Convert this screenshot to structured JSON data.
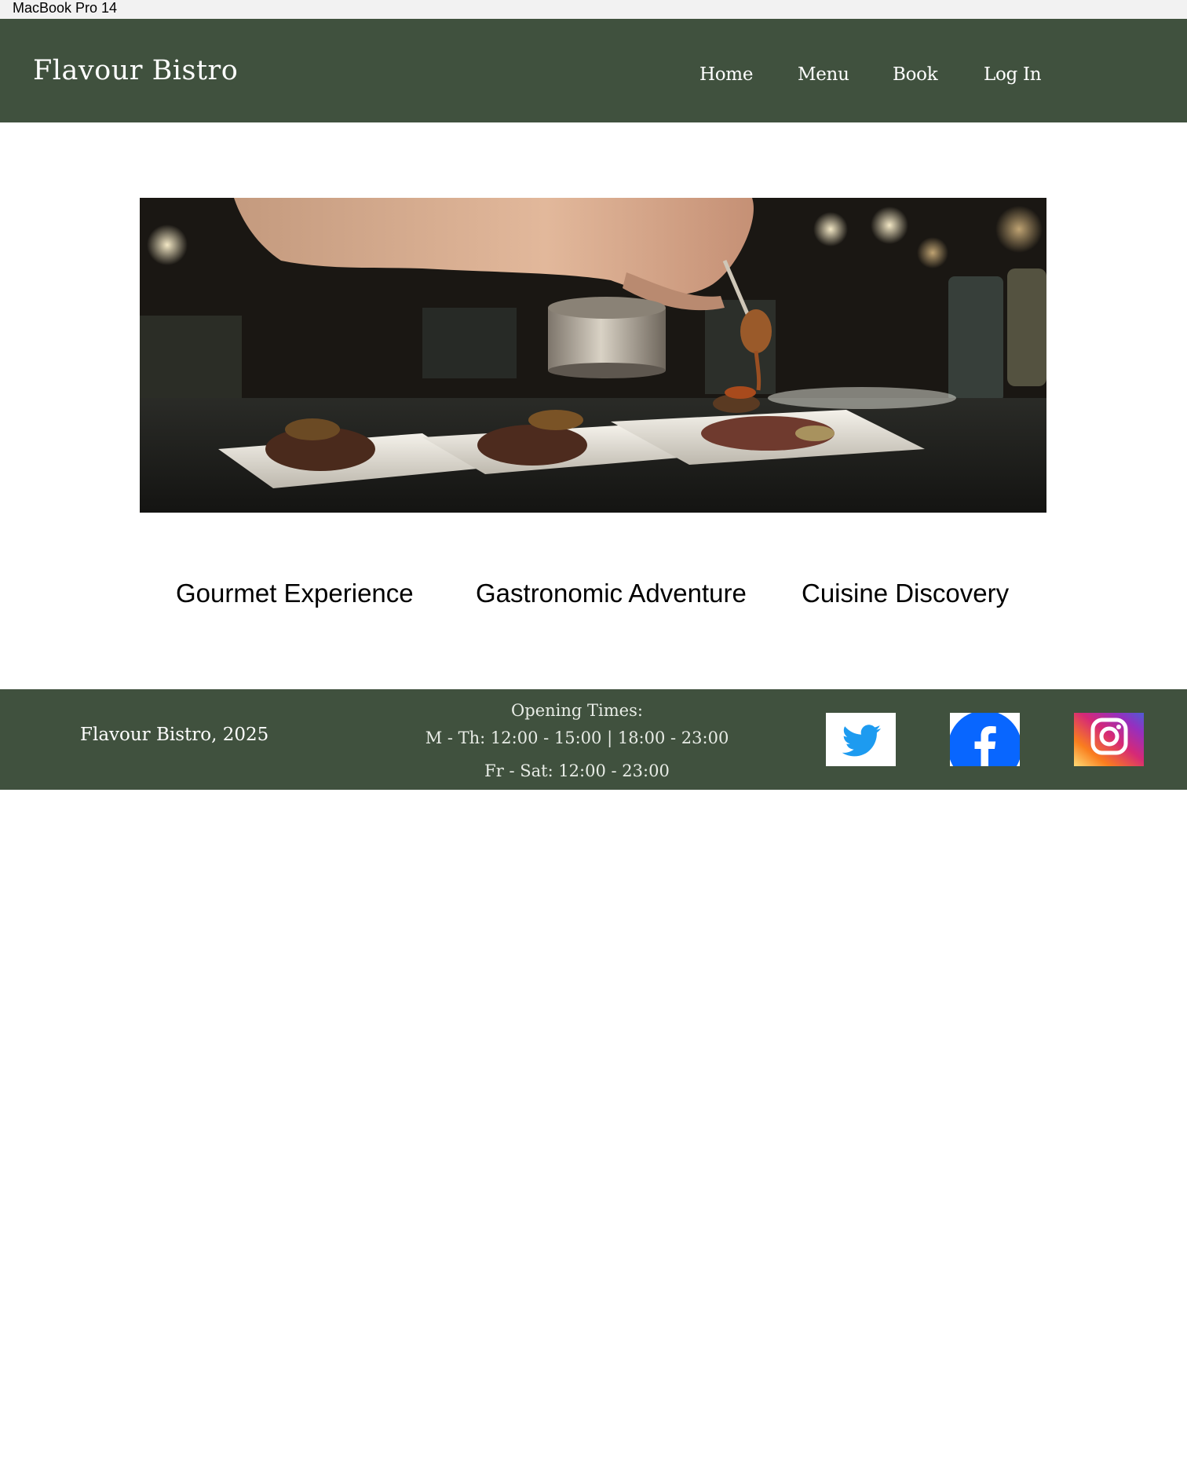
{
  "device_label": "MacBook Pro 14",
  "header": {
    "brand": "Flavour Bistro",
    "nav": [
      {
        "label": "Home"
      },
      {
        "label": "Menu"
      },
      {
        "label": "Book"
      },
      {
        "label": "Log  In"
      }
    ]
  },
  "hero": {
    "icon": "chef-plating-food-photo"
  },
  "features": [
    {
      "label": "Gourmet Experience"
    },
    {
      "label": "Gastronomic Adventure"
    },
    {
      "label": "Cuisine Discovery"
    }
  ],
  "footer": {
    "copyright": "Flavour Bistro, 2025",
    "hours": {
      "title": "Opening Times:",
      "line1": "M - Th:  12:00 - 15:00 | 18:00 - 23:00",
      "line2": "Fr - Sat: 12:00 - 23:00"
    },
    "social": [
      {
        "icon": "twitter-icon",
        "color": "#1d9bf0"
      },
      {
        "icon": "facebook-icon",
        "color": "#0866ff"
      },
      {
        "icon": "instagram-icon",
        "color": "#e1306c"
      }
    ]
  },
  "colors": {
    "header_bg": "#40513e",
    "footer_bg": "#40513e",
    "text_light": "#ffffff"
  }
}
